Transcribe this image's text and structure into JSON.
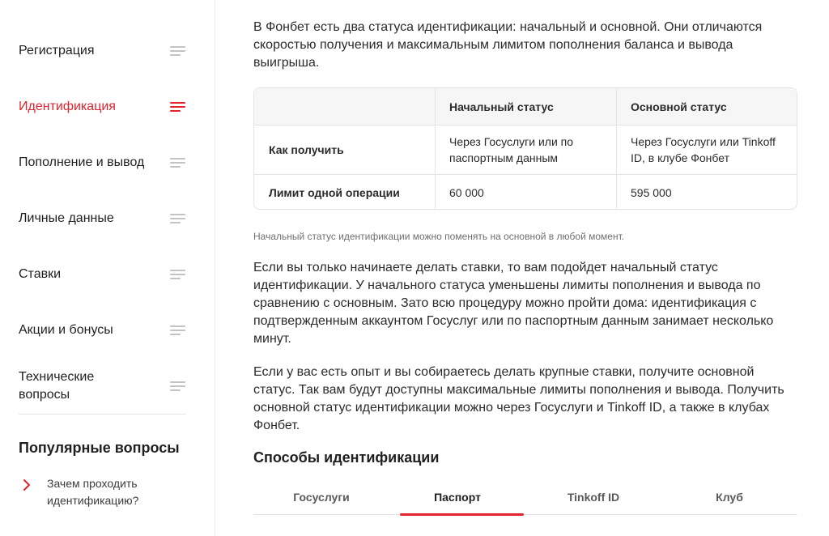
{
  "sidebar": {
    "items": [
      {
        "label": "Регистрация",
        "active": false
      },
      {
        "label": "Идентификация",
        "active": true
      },
      {
        "label": "Пополнение и вывод",
        "active": false
      },
      {
        "label": "Личные данные",
        "active": false
      },
      {
        "label": "Ставки",
        "active": false
      },
      {
        "label": "Акции и бонусы",
        "active": false
      },
      {
        "label": "Технические вопросы",
        "active": false
      }
    ],
    "popular": {
      "title": "Популярные вопросы",
      "items": [
        {
          "label": "Зачем проходить идентификацию?",
          "icon": "chevron-right-icon"
        }
      ]
    }
  },
  "main": {
    "intro": "В Фонбет есть два статуса идентификации: начальный и основной. Они отличаются скоростью получения и максимальным лимитом пополнения баланса и вывода выигрыша.",
    "table": {
      "headers": [
        "",
        "Начальный статус",
        "Основной статус"
      ],
      "rows": [
        [
          "Как получить",
          "Через Госуслуги или по паспортным данным",
          "Через Госуслуги или Tinkoff ID, в клубе Фонбет"
        ],
        [
          "Лимит одной операции",
          "60 000",
          "595 000"
        ]
      ]
    },
    "note": "Начальный статус идентификации можно поменять на основной в любой момент.",
    "para1": "Если вы только начинаете делать ставки, то вам подойдет начальный статус идентификации. У начального статуса уменьшены лимиты пополнения и вывода по сравнению с основным. Зато всю процедуру можно пройти дома: идентификация с подтвержденным аккаунтом Госуслуг или по паспортным данным занимает несколько минут.",
    "para2": "Если у вас есть опыт и вы собираетесь делать крупные ставки, получите основной статус. Так вам будут доступны максимальные лимиты пополнения и вывода. Получить основной статус идентификации можно через Госуслуги и Tinkoff ID, а также в клубах Фонбет.",
    "methods_title": "Способы идентификации",
    "tabs": [
      {
        "label": "Госуслуги",
        "active": false
      },
      {
        "label": "Паспорт",
        "active": true
      },
      {
        "label": "Tinkoff ID",
        "active": false
      },
      {
        "label": "Клуб",
        "active": false
      }
    ]
  },
  "colors": {
    "accent": "#e3222d",
    "text": "#1f1f1f",
    "muted": "#6f6f6f",
    "border": "#e4e4e4"
  }
}
